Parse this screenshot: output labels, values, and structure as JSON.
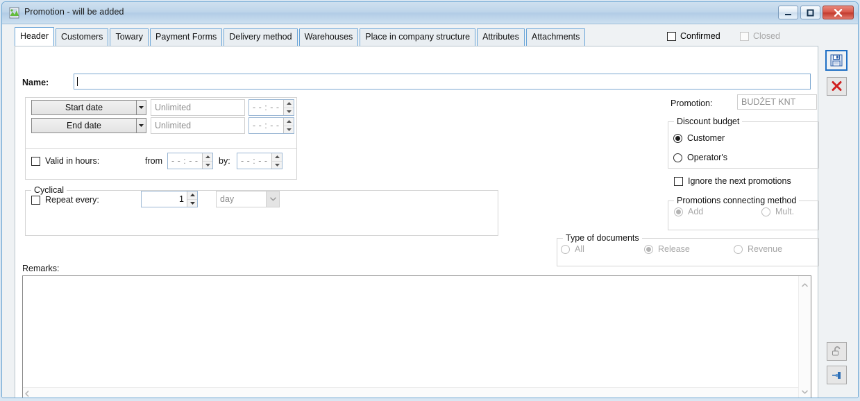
{
  "window": {
    "title": "Promotion - will be added",
    "icon": "app-icon",
    "controls": {
      "minimize": "minimize-icon",
      "maximize": "maximize-icon",
      "close": "close-icon"
    }
  },
  "tabs": [
    {
      "label": "Header",
      "active": true
    },
    {
      "label": "Customers",
      "active": false
    },
    {
      "label": "Towary",
      "active": false
    },
    {
      "label": "Payment Forms",
      "active": false
    },
    {
      "label": "Delivery method",
      "active": false
    },
    {
      "label": "Warehouses",
      "active": false
    },
    {
      "label": "Place in company structure",
      "active": false
    },
    {
      "label": "Attributes",
      "active": false
    },
    {
      "label": "Attachments",
      "active": false
    }
  ],
  "header_checks": {
    "confirmed": {
      "label": "Confirmed",
      "checked": false,
      "enabled": true
    },
    "closed": {
      "label": "Closed",
      "checked": false,
      "enabled": false
    }
  },
  "form": {
    "name": {
      "label": "Name:",
      "value": "",
      "placeholder": ""
    },
    "dates": {
      "start": {
        "button": "Start date",
        "value": "",
        "placeholder": "Unlimited",
        "time": "- - : - -"
      },
      "end": {
        "button": "End date",
        "value": "",
        "placeholder": "Unlimited",
        "time": "- - : - -"
      }
    },
    "valid_in_hours": {
      "label": "Valid in hours:",
      "checked": false,
      "from_label": "from",
      "from_value": "- - : - -",
      "by_label": "by:",
      "by_value": "- - : - -"
    },
    "cyclical": {
      "title": "Cyclical",
      "repeat": {
        "label": "Repeat every:",
        "checked": false
      },
      "count": "1",
      "unit": "day"
    },
    "remarks": {
      "label": "Remarks:",
      "value": ""
    }
  },
  "right_panel": {
    "promotion": {
      "label": "Promotion:",
      "value": "BUDŻET KNT"
    },
    "discount_budget": {
      "title": "Discount budget",
      "options": [
        {
          "label": "Customer",
          "selected": true
        },
        {
          "label": "Operator's",
          "selected": false
        }
      ]
    },
    "ignore_next": {
      "label": "Ignore the next promotions",
      "checked": false
    },
    "connecting_method": {
      "title": "Promotions connecting method",
      "options": [
        {
          "label": "Add",
          "selected": true
        },
        {
          "label": "Mult.",
          "selected": false
        }
      ]
    }
  },
  "type_of_documents": {
    "title": "Type of documents",
    "options": [
      {
        "label": "All",
        "selected": false
      },
      {
        "label": "Release",
        "selected": true
      },
      {
        "label": "Revenue",
        "selected": false
      }
    ]
  },
  "toolbar": {
    "save": "save-icon",
    "cancel": "cancel-icon",
    "lock": "unlock-icon",
    "pin": "pin-icon"
  },
  "colors": {
    "accent": "#1f6fc4",
    "tab_border": "#6aa5d8",
    "title_bar": "#bed5ea",
    "close_button": "#c1392c"
  }
}
